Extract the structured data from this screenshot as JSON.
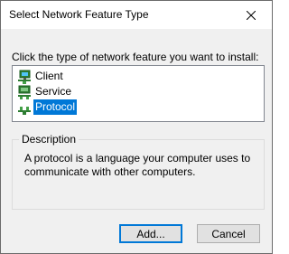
{
  "window": {
    "title": "Select Network Feature Type",
    "close_icon": "close-icon"
  },
  "instruction": "Click the type of network feature you want to install:",
  "list": {
    "items": [
      {
        "label": "Client",
        "icon": "client-icon",
        "selected": false
      },
      {
        "label": "Service",
        "icon": "service-icon",
        "selected": false
      },
      {
        "label": "Protocol",
        "icon": "protocol-icon",
        "selected": true
      }
    ]
  },
  "description": {
    "legend": "Description",
    "text": "A protocol is a language your computer uses to communicate with other computers."
  },
  "buttons": {
    "add_label": "Add...",
    "cancel_label": "Cancel"
  },
  "colors": {
    "selection": "#0078d7",
    "dialog_bg": "#f0f0f0"
  }
}
